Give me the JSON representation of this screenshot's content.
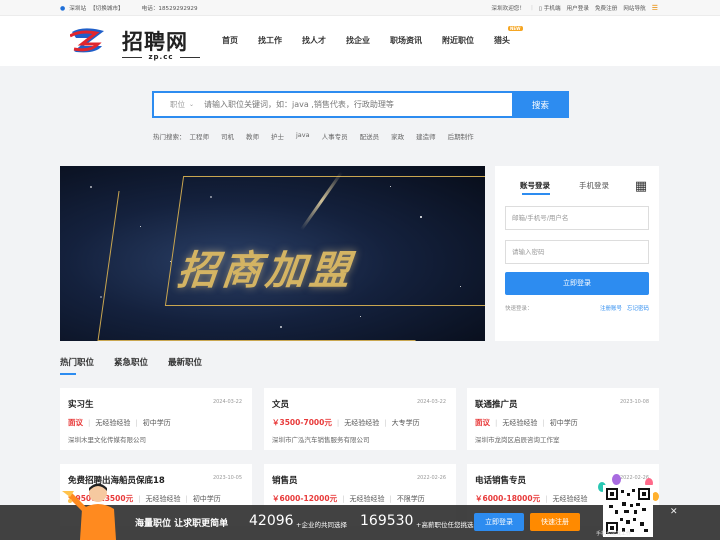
{
  "topbar": {
    "station": "深圳站",
    "switch_city": "【切换城市】",
    "phone_label": "电话：18529292929",
    "welcome": "深圳欢迎您！",
    "mobile": "手机端",
    "user_login": "用户登录",
    "free_register": "免费注册",
    "site_nav": "网站导航"
  },
  "logo": {
    "name": "招聘网",
    "domain": "zp.cc"
  },
  "nav": [
    "首页",
    "找工作",
    "找人才",
    "找企业",
    "职场资讯",
    "附近职位",
    "猎头"
  ],
  "search": {
    "type_label": "职位",
    "placeholder": "请输入职位关键词，如：java ,销售代表，行政助理等",
    "button": "搜索",
    "hot_label": "热门搜索：",
    "hot_terms": [
      "工程师",
      "司机",
      "教师",
      "护士",
      "java",
      "人事专员",
      "配送员",
      "家政",
      "建造师",
      "后期制作"
    ]
  },
  "banner": {
    "title": "招商加盟"
  },
  "login": {
    "tab_account": "账号登录",
    "tab_phone": "手机登录",
    "username_placeholder": "邮箱/手机号/用户名",
    "password_placeholder": "请输入密码",
    "submit": "立即登录",
    "quick_login": "快速登录：",
    "register": "注册账号",
    "forgot": "忘记密码"
  },
  "job_tabs": [
    "热门职位",
    "紧急职位",
    "最新职位"
  ],
  "jobs": [
    {
      "title": "实习生",
      "date": "2024-03-22",
      "salary": "面议",
      "exp": "无经验经验",
      "edu": "初中学历",
      "company": "深圳木里文化传媒有限公司"
    },
    {
      "title": "文员",
      "date": "2024-03-22",
      "salary": "￥3500-7000元",
      "exp": "无经验经验",
      "edu": "大专学历",
      "company": "深圳市广泓汽车销售服务有限公司"
    },
    {
      "title": "联通推广员",
      "date": "2023-10-08",
      "salary": "面议",
      "exp": "无经验经验",
      "edu": "初中学历",
      "company": "深圳市龙岗区启辰咨询工作室"
    },
    {
      "title": "免费招聘出海船员保底18",
      "date": "2023-10-05",
      "salary": "￥9500-13500元",
      "exp": "无经验经验",
      "edu": "初中学历",
      "company": ""
    },
    {
      "title": "销售员",
      "date": "2022-02-26",
      "salary": "￥6000-12000元",
      "exp": "无经验经验",
      "edu": "不限学历",
      "company": ""
    },
    {
      "title": "电话销售专员",
      "date": "2022-02-26",
      "salary": "￥6000-18000元",
      "exp": "无经验经验",
      "edu": "",
      "company": ""
    }
  ],
  "bottom": {
    "slogan": "海量职位 让求职更简单",
    "count1": "42096",
    "label1": "+企业的共同选择",
    "count2": "169530",
    "label2": "+高薪职位任您挑选",
    "btn_login": "立即登录",
    "btn_register": "快速注册",
    "qr_caption": "手机也能找工作",
    "close": "✕"
  },
  "colors": {
    "primary": "#2d8cf0",
    "salary": "#e83a3a",
    "orange": "#ff8a00"
  }
}
